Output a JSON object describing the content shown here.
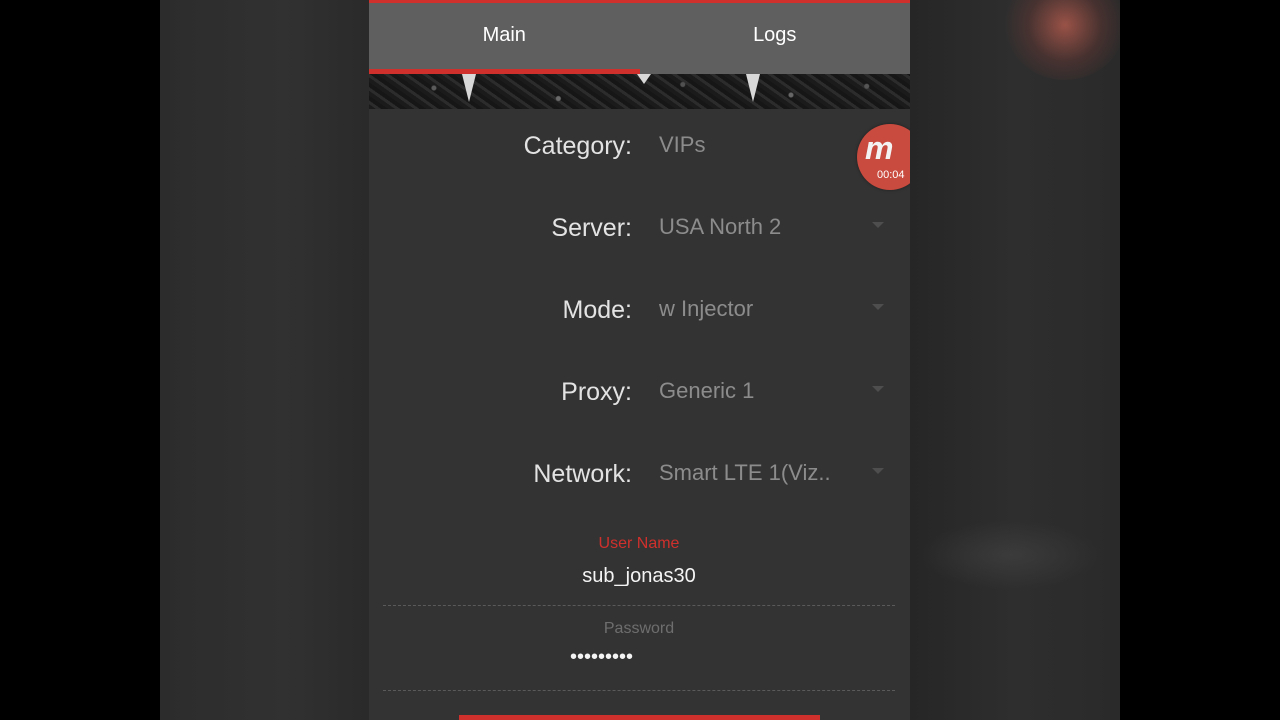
{
  "tabs": [
    {
      "label": "Main",
      "active": true
    },
    {
      "label": "Logs",
      "active": false
    }
  ],
  "settings": [
    {
      "label": "Category:",
      "value": "VIPs",
      "has_dropdown": false
    },
    {
      "label": "Server:",
      "value": "USA North 2",
      "has_dropdown": true
    },
    {
      "label": "Mode:",
      "value": "w Injector",
      "has_dropdown": true
    },
    {
      "label": "Proxy:",
      "value": "Generic 1",
      "has_dropdown": true
    },
    {
      "label": "Network:",
      "value": "Smart LTE 1(Viz..",
      "has_dropdown": true
    }
  ],
  "username": {
    "label": "User Name",
    "value": "sub_jonas30"
  },
  "password": {
    "label": "Password",
    "value": "•••••••••"
  },
  "recorder": {
    "glyph": "m",
    "time": "00:04"
  },
  "colors": {
    "accent": "#d0302c",
    "panel": "#333333",
    "tabbar": "#5f5f5f",
    "label_text": "#e3e3e3",
    "value_text": "#8c8c8c",
    "active_field_label": "#d0302c",
    "inactive_field_label": "#6e6e6e"
  }
}
